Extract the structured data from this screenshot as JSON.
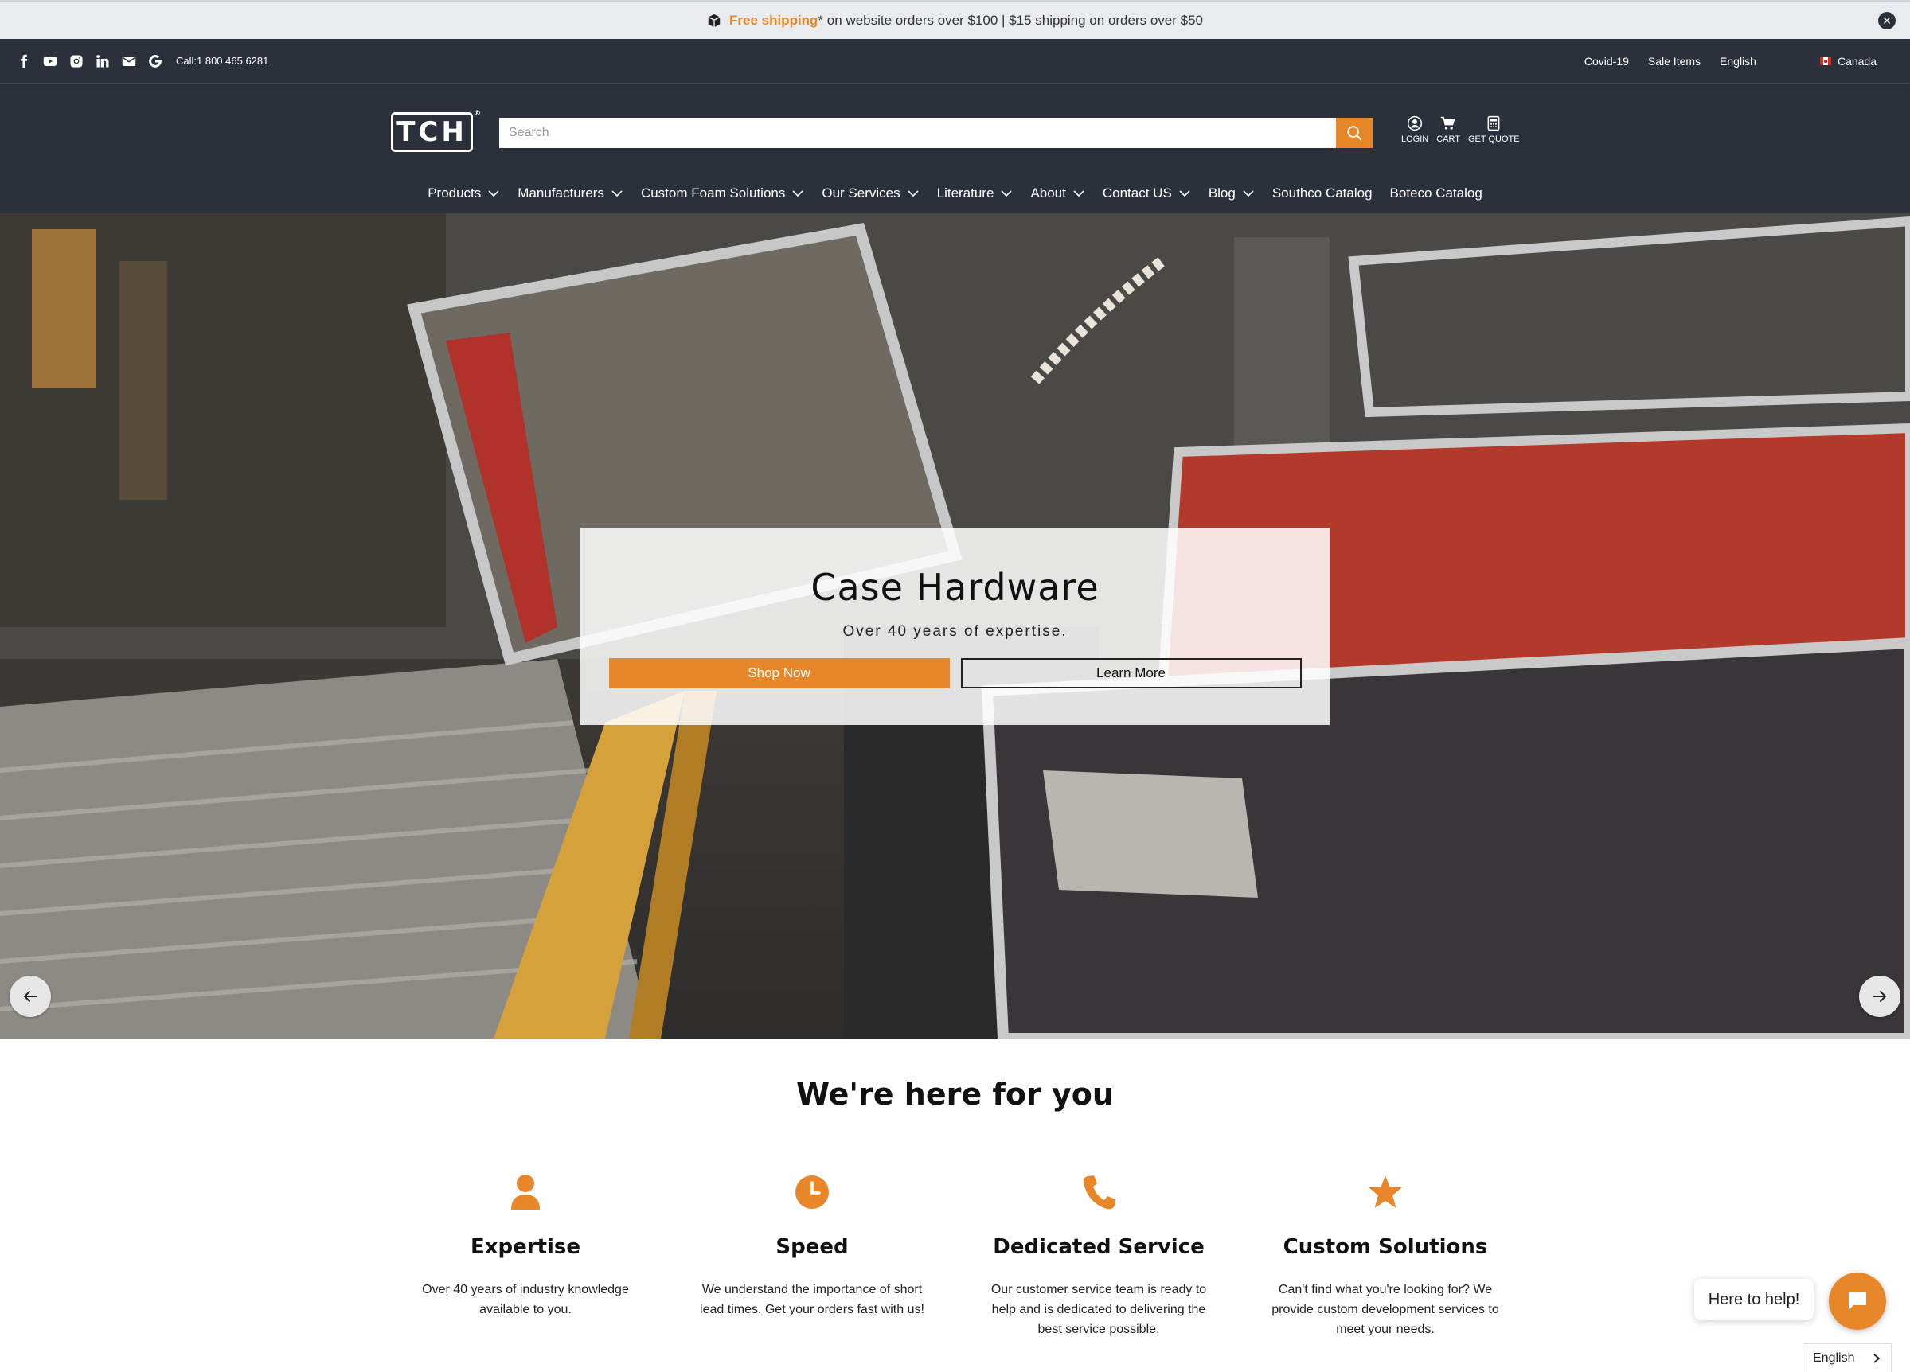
{
  "colors": {
    "accent": "#e8862a",
    "header_bg": "#2c303a"
  },
  "announcement": {
    "highlight": "Free shipping",
    "rest": "* on website orders over $100 | $15 shipping on orders over $50",
    "icon": "box-icon"
  },
  "utility": {
    "socials": [
      "facebook-icon",
      "youtube-icon",
      "instagram-icon",
      "linkedin-icon",
      "email-icon",
      "google-icon"
    ],
    "call": "Call:1 800 465 6281",
    "links": {
      "covid": "Covid-19",
      "sale": "Sale Items",
      "language": "English",
      "country": "Canada"
    }
  },
  "header": {
    "logo": "TCH",
    "logo_mark": "®",
    "search_placeholder": "Search",
    "icons": {
      "login": "LOGIN",
      "cart": "CART",
      "quote": "GET QUOTE"
    }
  },
  "nav": {
    "items": [
      {
        "label": "Products",
        "dropdown": true
      },
      {
        "label": "Manufacturers",
        "dropdown": true
      },
      {
        "label": "Custom Foam Solutions",
        "dropdown": true
      },
      {
        "label": "Our Services",
        "dropdown": true
      },
      {
        "label": "Literature",
        "dropdown": true
      },
      {
        "label": "About",
        "dropdown": true
      },
      {
        "label": "Contact US",
        "dropdown": true
      },
      {
        "label": "Blog",
        "dropdown": true
      },
      {
        "label": "Southco Catalog",
        "dropdown": false
      },
      {
        "label": "Boteco Catalog",
        "dropdown": false
      }
    ]
  },
  "hero": {
    "title": "Case Hardware",
    "subtitle": "Over 40 years of expertise.",
    "shop_label": "Shop Now",
    "learn_label": "Learn More"
  },
  "features": {
    "title": "We're here for you",
    "items": [
      {
        "icon": "person-icon",
        "title": "Expertise",
        "text": "Over 40 years of industry knowledge available to you."
      },
      {
        "icon": "clock-icon",
        "title": "Speed",
        "text": "We understand the importance of short lead times. Get your orders fast with us!"
      },
      {
        "icon": "phone-icon",
        "title": "Dedicated Service",
        "text": "Our customer service team is ready to help and is dedicated to delivering the best service possible."
      },
      {
        "icon": "star-icon",
        "title": "Custom Solutions",
        "text": "Can't find what you're looking for? We provide custom development services to meet your needs."
      }
    ]
  },
  "chat": {
    "bubble": "Here to help!"
  },
  "language_widget": {
    "label": "English"
  }
}
